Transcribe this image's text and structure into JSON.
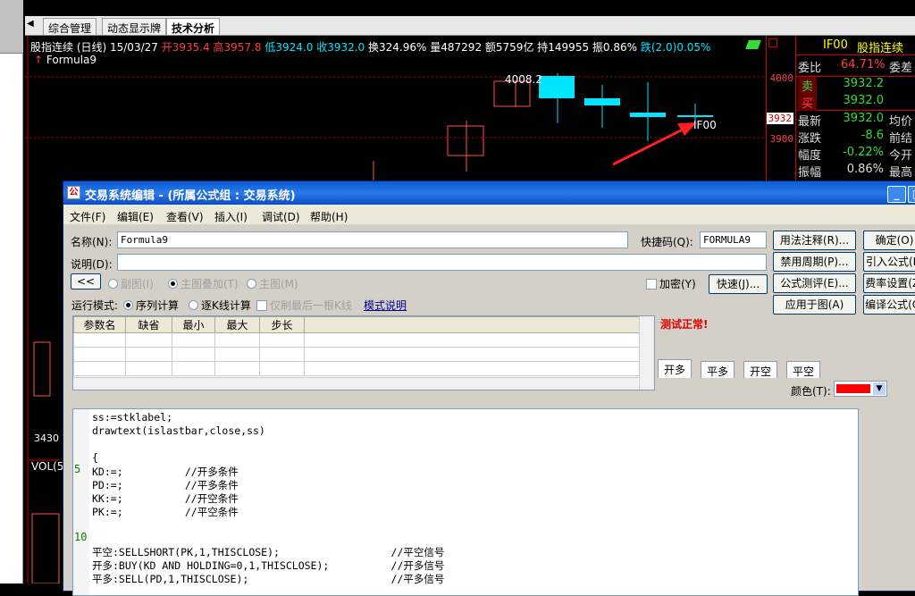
{
  "tabs": [
    "综合管理",
    "动态显示牌",
    "技术分析"
  ],
  "info": {
    "name": "股指连续 (日线) 15/03/27",
    "open": "开3935.4",
    "high": "高3957.8",
    "low": "低3924.0",
    "close": "收3932.0",
    "turnover": "换324.96%",
    "volume": "量487292",
    "amount": "额5759亿",
    "hold": "持149955",
    "amp": "振0.86%",
    "chg": "跌(2.0)0.05%"
  },
  "formula_label": "Formula9",
  "chart": {
    "peak_label": "4008.2",
    "marker_label": "IF00",
    "axis": [
      "4000",
      "3932",
      "3900"
    ],
    "low_label": "3430",
    "vol_label": "VOL(5"
  },
  "quote": {
    "title": "IF00",
    "title2": "股指连续",
    "rows": [
      {
        "k": "委比",
        "v": "64.71%",
        "k2": "委差"
      },
      {
        "k": "卖",
        "v": "3932.2",
        "k2": ""
      },
      {
        "k": "买",
        "v": "3932.0",
        "k2": ""
      },
      {
        "k": "最新",
        "v": "3932.0",
        "k2": "均价"
      },
      {
        "k": "涨跌",
        "v": "-8.6",
        "k2": "前结"
      },
      {
        "k": "幅度",
        "v": "-0.22%",
        "k2": "今开"
      },
      {
        "k": "振幅",
        "v": "0.86%",
        "k2": "最高"
      }
    ]
  },
  "dialog": {
    "title": "交易系统编辑 - (所属公式组 : 交易系统)",
    "menus": [
      "文件(F)",
      "编辑(E)",
      "查看(V)",
      "插入(I)",
      "调试(D)",
      "帮助(H)"
    ],
    "name_label": "名称(N):",
    "name_value": "Formula9",
    "shortcut_label": "快捷码(Q):",
    "shortcut_value": "FORMULA9",
    "desc_label": "说明(D):",
    "collapse": "<<",
    "radios_top": [
      "副图(I)",
      "主图叠加(T)",
      "主图(M)"
    ],
    "encrypt": "加密(Y)",
    "fast": "快速(J)...",
    "run_label": "运行模式:",
    "run_opt1": "序列计算",
    "run_opt2": "逐K线计算",
    "run_opt3": "仅刷最后一根K线",
    "mode_link": "模式说明",
    "grid_headers": [
      "参数名",
      "缺省",
      "最小",
      "最大",
      "步长"
    ],
    "status": "测试正常!",
    "sig_tabs": [
      "开多",
      "平多",
      "开空",
      "平空"
    ],
    "color_label": "颜色(T):",
    "buttons": [
      "用法注释(R)...",
      "确定(O)",
      "禁用周期(P)...",
      "引入公式(L)",
      "公式测评(E)...",
      "费率设置(Z)",
      "应用于图(A)",
      "编译公式(C)"
    ],
    "code": [
      "ss:=stklabel;",
      "drawtext(islastbar,close,ss)",
      "",
      "{",
      "KD:=;          //开多条件",
      "PD:=;          //平多条件",
      "KK:=;          //开空条件",
      "PK:=;          //平空条件",
      "",
      "",
      "平空:SELLSHORT(PK,1,THISCLOSE);                  //平空信号",
      "开多:BUY(KD AND HOLDING=0,1,THISCLOSE);          //开多信号",
      "平多:SELL(PD,1,THISCLOSE);                       //平多信号"
    ],
    "line_numbers": [
      "5",
      "10"
    ]
  }
}
